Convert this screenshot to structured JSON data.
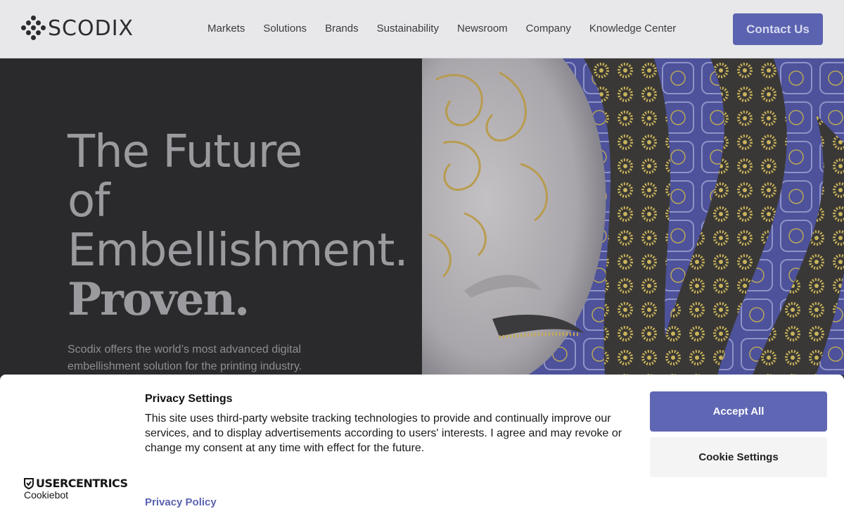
{
  "header": {
    "logo_text": "SCODIX",
    "nav": [
      "Markets",
      "Solutions",
      "Brands",
      "Sustainability",
      "Newsroom",
      "Company",
      "Knowledge Center"
    ],
    "contact_label": "Contact Us"
  },
  "hero": {
    "title_lines": [
      "The Future",
      "of",
      "Embellishment."
    ],
    "title_emphasis": "Proven.",
    "description": "Scodix offers the world’s most advanced digital embellishment solution for the printing industry."
  },
  "consent": {
    "title": "Privacy Settings",
    "text": "This site uses third-party website tracking technologies to provide and continually improve our services, and to display advertisements according to users' interests. I agree and may revoke or change my consent at any time with effect for the future.",
    "privacy_link": "Privacy Policy",
    "accept_label": "Accept All",
    "settings_label": "Cookie Settings",
    "brand": "USERCENTRICS",
    "brand_sub": "Cookiebot"
  },
  "colors": {
    "accent": "#5f67b4",
    "header_bg": "#e8e8ea",
    "hero_bg": "#2a2a2d"
  }
}
